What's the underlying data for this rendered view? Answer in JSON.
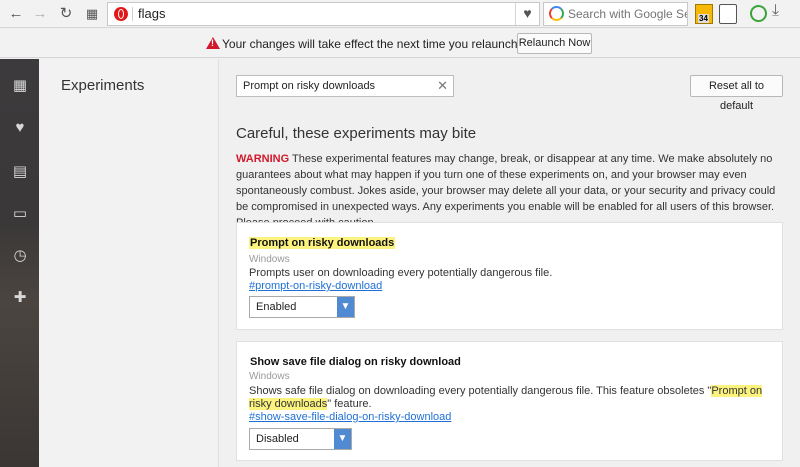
{
  "toolbar": {
    "back_icon": "back-arrow-icon",
    "forward_icon": "forward-arrow-icon",
    "reload_icon": "reload-icon",
    "speed_dial_icon": "grid-icon",
    "url": "flags",
    "search_placeholder": "Search with Google Se",
    "ext_badge": "34"
  },
  "infobar": {
    "message": "Your changes will take effect the next time you relaunch Opera.",
    "relaunch_label": "Relaunch Now"
  },
  "sidebar": {
    "icons": [
      "speed-dial-icon",
      "bookmarks-heart-icon",
      "news-icon",
      "tabs-devices-icon",
      "history-clock-icon",
      "extensions-puzzle-icon"
    ]
  },
  "left": {
    "title": "Experiments"
  },
  "main": {
    "filter_value": "Prompt on risky downloads",
    "reset_label": "Reset all to default",
    "heading": "Careful, these experiments may bite",
    "warning_label": "WARNING",
    "warning_text": " These experimental features may change, break, or disappear at any time. We make absolutely no guarantees about what may happen if you turn one of these experiments on, and your browser may even spontaneously combust. Jokes aside, your browser may delete all your data, or your security and privacy could be compromised in unexpected ways. Any experiments you enable will be enabled for all users of this browser. Please proceed with caution."
  },
  "experiments": [
    {
      "title": "Prompt on risky downloads",
      "platform": "Windows",
      "description": "Prompts user on downloading every potentially dangerous file.",
      "link": "#prompt-on-risky-download",
      "selected": "Enabled"
    },
    {
      "title": "Show save file dialog on risky download",
      "platform": "Windows",
      "description_pre": "Shows safe file dialog on downloading every potentially dangerous file. This feature obsoletes \"",
      "description_hl": "Prompt on risky downloads",
      "description_post": "\" feature.",
      "link": "#show-save-file-dialog-on-risky-download",
      "selected": "Disabled"
    }
  ],
  "colors": {
    "accent": "#d0192c",
    "highlight": "#fcf37f",
    "link": "#1e70d6",
    "select": "#4f8ad3"
  }
}
